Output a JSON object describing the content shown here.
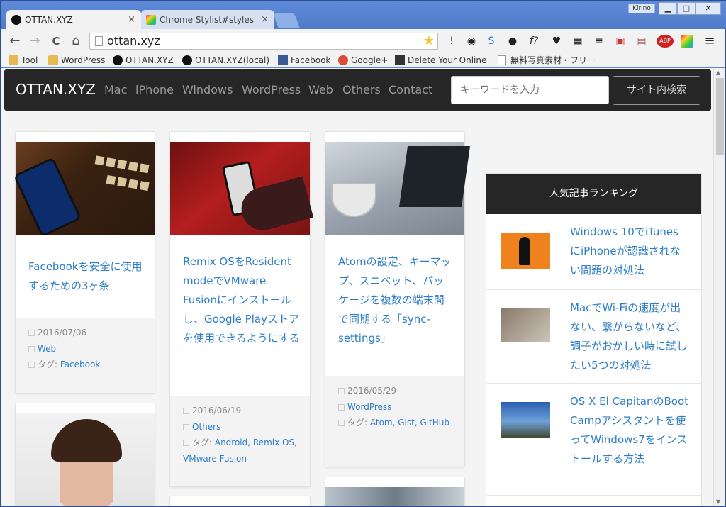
{
  "browser": {
    "tabs": [
      {
        "title": "OTTAN.XYZ",
        "close": "×"
      },
      {
        "title": "Chrome Stylist#styles",
        "close": "×"
      }
    ],
    "user": "Kirino",
    "window_controls": {
      "minimize": "▁",
      "maximize": "□",
      "close": "✕"
    },
    "url": "ottan.xyz",
    "nav_glyphs": {
      "back": "←",
      "forward": "→",
      "reload": "C",
      "home": "⌂"
    },
    "bookmarks": [
      {
        "label": "Tool",
        "icon": "folder-icon"
      },
      {
        "label": "WordPress",
        "icon": "folder-icon"
      },
      {
        "label": "OTTAN.XYZ",
        "icon": "site-icon"
      },
      {
        "label": "OTTAN.XYZ(local)",
        "icon": "site-icon"
      },
      {
        "label": "Facebook",
        "icon": "facebook-icon"
      },
      {
        "label": "Google+",
        "icon": "google-plus-icon"
      },
      {
        "label": "Delete Your Online",
        "icon": "delete-icon"
      },
      {
        "label": "無料写真素材・フリー",
        "icon": "page-icon"
      }
    ],
    "extensions": [
      "!",
      "◉",
      "S",
      "●",
      "f?",
      "♥",
      "▦",
      "≡",
      "▣",
      "▤",
      "ABP",
      "▨",
      "≡"
    ]
  },
  "site": {
    "brand": "OTTAN.XYZ",
    "nav": [
      "Mac",
      "iPhone",
      "Windows",
      "WordPress",
      "Web",
      "Others",
      "Contact"
    ],
    "search_placeholder": "キーワードを入力",
    "search_button": "サイト内検索"
  },
  "posts": [
    {
      "title": "Facebookを安全に使用するための3ヶ条",
      "date": "2016/07/06",
      "category": "Web",
      "tags_label": "タグ: ",
      "tags": "Facebook"
    },
    {
      "title": "Remix OSをResident modeでVMware Fusionにインストールし、Google Playストアを使用できるようにする",
      "date": "2016/06/19",
      "category": "Others",
      "tags_label": "タグ: ",
      "tags": "Android, Remix OS, VMware Fusion"
    },
    {
      "title": "Atomの設定、キーマップ、スニペット、パッケージを複数の端末間で同期する「sync-settings」",
      "date": "2016/05/29",
      "category": "WordPress",
      "tags_label": "タグ: ",
      "tags": "Atom, Gist, GitHub"
    }
  ],
  "ranking": {
    "heading": "人気記事ランキング",
    "items": [
      {
        "title": "Windows 10でiTunesにiPhoneが認識されない問題の対処法"
      },
      {
        "title": "MacでWi-Fiの速度が出ない、繋がらないなど、調子がおかしい時に試したい5つの対処法"
      },
      {
        "title": "OS X El CapitanのBoot Campアシスタントを使ってWindows7をインストールする方法"
      }
    ]
  },
  "colors": {
    "link": "#2d7ec9",
    "nav_bg": "#262626",
    "chrome_frame": "#5b86d6"
  }
}
